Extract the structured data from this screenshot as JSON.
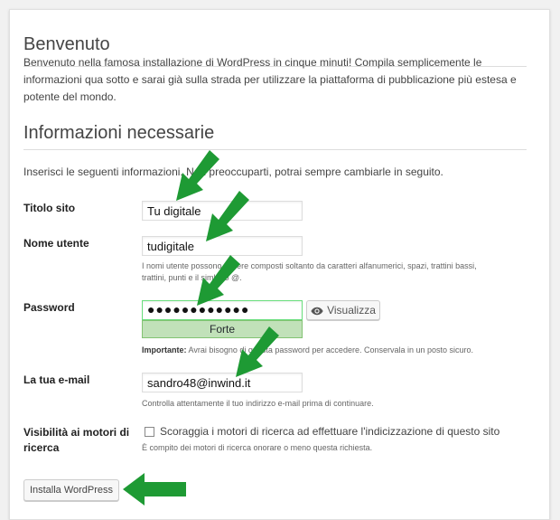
{
  "welcome": {
    "title": "Benvenuto",
    "text": "Benvenuto nella famosa installazione di WordPress in cinque minuti! Compila semplicemente le informazioni qua sotto e sarai già sulla strada per utilizzare la piattaforma di pubblicazione più estesa e potente del mondo."
  },
  "info": {
    "title": "Informazioni necessarie",
    "intro": "Inserisci le seguenti informazioni. Non preoccuparti, potrai sempre cambiarle in seguito."
  },
  "form": {
    "site_title": {
      "label": "Titolo sito",
      "value": "Tu digitale"
    },
    "username": {
      "label": "Nome utente",
      "value": "tudigitale",
      "description": "I nomi utente possono essere composti soltanto da caratteri alfanumerici, spazi, trattini bassi, trattini, punti e il simbolo @."
    },
    "password": {
      "label": "Password",
      "value": "●●●●●●●●●●●●",
      "strength": "Forte",
      "show_label": "Visualizza",
      "note_strong": "Importante:",
      "note": " Avrai bisogno di questa password per accedere. Conservala in un posto sicuro."
    },
    "email": {
      "label": "La tua e-mail",
      "value": "sandro48@inwind.it",
      "description": "Controlla attentamente il tuo indirizzo e-mail prima di continuare."
    },
    "visibility": {
      "label": "Visibilità ai motori di ricerca",
      "checkbox_label": "Scoraggia i motori di ricerca ad effettuare l'indicizzazione di questo sito",
      "description": "È compito dei motori di ricerca onorare o meno questa richiesta."
    },
    "submit_label": "Installa WordPress"
  },
  "colors": {
    "arrow": "#1e9a34",
    "strength_bg": "#c1e1b9",
    "password_border": "#68de7c"
  }
}
